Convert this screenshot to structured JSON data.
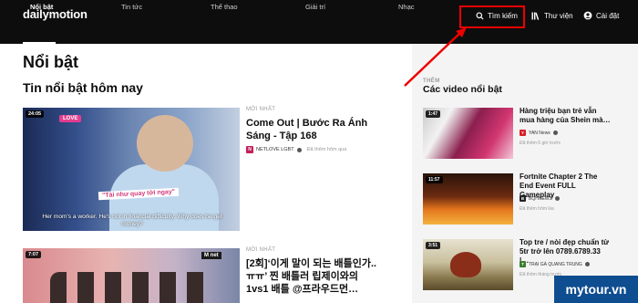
{
  "header": {
    "logo": "dailymotion",
    "search_label": "Tìm kiếm",
    "library_label": "Thư viện",
    "settings_label": "Cài đặt"
  },
  "nav": {
    "items": [
      {
        "label": "Nổi bật",
        "active": true
      },
      {
        "label": "Tin tức",
        "active": false
      },
      {
        "label": "Thể thao",
        "active": false
      },
      {
        "label": "Giải trí",
        "active": false
      },
      {
        "label": "Nhạc",
        "active": false
      }
    ]
  },
  "main": {
    "page_title": "Nổi bật",
    "section_title": "Tin nổi bật hôm nay",
    "cards": [
      {
        "duration": "24:05",
        "badge": "LOVE",
        "sticker": "\"Tài như quay tới ngay\"",
        "subtitle": "Her mom's a worker. He's not in financial difficulty. Why does he get money?",
        "category": "MỚI NHẤT",
        "title": "Come Out | Bước Ra Ánh Sáng - Tập 168",
        "channel": "NETLOVE LGBT",
        "channel_initial": "N",
        "posted": "Đã thêm hôm qua"
      },
      {
        "duration": "7:07",
        "badge": "M net",
        "category": "MỚI NHẤT",
        "title": "[2회]‘이게 말이 되는 배틀인가..ㅠㅠ’ 찐 배틀러 립제이와의 1vs1 배틀 @프라우드먼…"
      }
    ]
  },
  "right_panel": {
    "label": "THÊM",
    "title": "Các video nổi bật",
    "videos": [
      {
        "duration": "1:47",
        "title": "Hàng triệu bạn trẻ vẫn mua hàng của Shein mà…",
        "channel": "YAN News",
        "channel_initial": "Y",
        "posted": "Đã thêm 6 giờ trước"
      },
      {
        "duration": "11:57",
        "title": "Fortnite Chapter 2 The End Event FULL Gameplay",
        "channel": "BQHNEWS",
        "channel_initial": "B",
        "posted": "Đã thêm hôm kia"
      },
      {
        "duration": "3:51",
        "title": "Top tre / nòi đẹp chuẩn từ 5tr trở lên 0789.6789.33 |…",
        "channel": "TRẠI GÀ QUANG TRUNG",
        "channel_initial": "T",
        "posted": "Đã thêm tháng trước"
      }
    ]
  },
  "watermark": "mytour.vn",
  "colors": {
    "header_bg": "#0d0d0d",
    "highlight": "#ee0000",
    "panel_bg": "#f4f4f4",
    "watermark_bg": "#0e4d8f"
  },
  "icons": {
    "search": "search-icon",
    "library": "library-icon",
    "settings": "user-circle-icon",
    "verified": "verified-check-icon"
  }
}
